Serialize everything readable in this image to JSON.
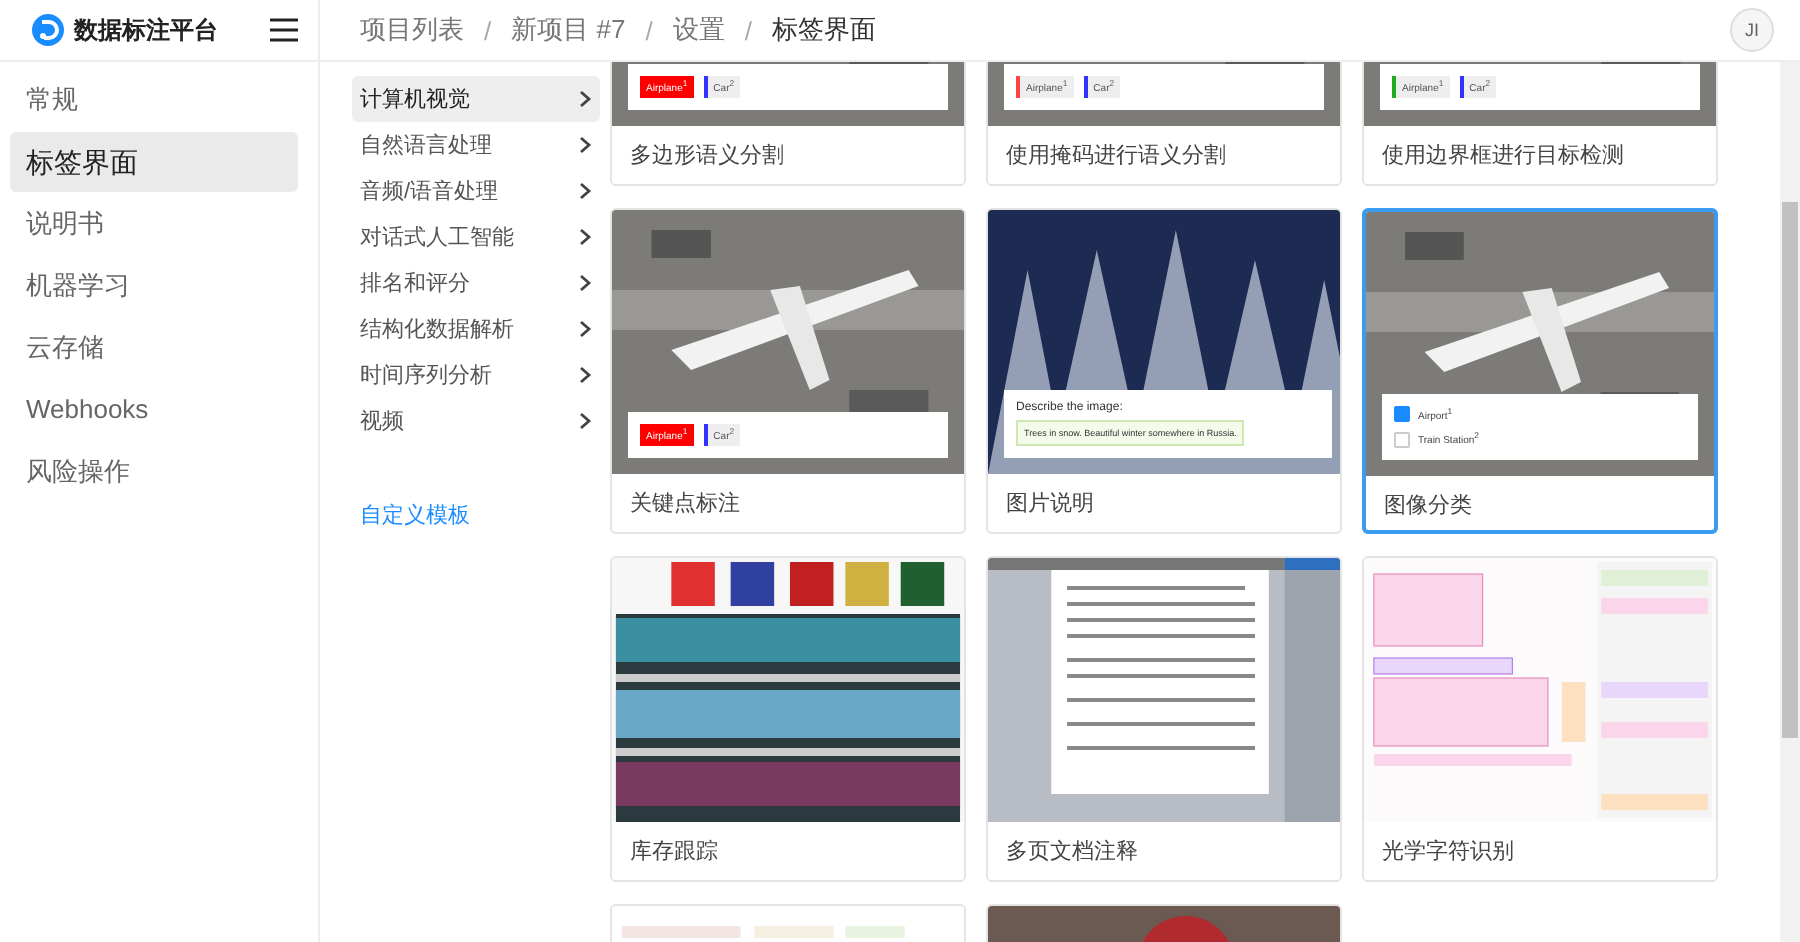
{
  "header": {
    "app_name": "数据标注平台",
    "breadcrumb": [
      {
        "label": "项目列表"
      },
      {
        "sep": "/",
        "label": "新项目 #7"
      },
      {
        "sep": "/",
        "label": "设置"
      },
      {
        "sep": "/",
        "label": "标签界面"
      }
    ],
    "avatar": "JI"
  },
  "sidebar": {
    "items": [
      {
        "label": "常规",
        "selected": false
      },
      {
        "label": "标签界面",
        "selected": true
      },
      {
        "label": "说明书",
        "selected": false
      },
      {
        "label": "机器学习",
        "selected": false
      },
      {
        "label": "云存储",
        "selected": false
      },
      {
        "label": "Webhooks",
        "selected": false
      },
      {
        "label": "风险操作",
        "selected": false
      }
    ]
  },
  "categories": {
    "items": [
      {
        "label": "计算机视觉",
        "selected": true
      },
      {
        "label": "自然语言处理",
        "selected": false
      },
      {
        "label": "音频/语音处理",
        "selected": false
      },
      {
        "label": "对话式人工智能",
        "selected": false
      },
      {
        "label": "排名和评分",
        "selected": false
      },
      {
        "label": "结构化数据解析",
        "selected": false
      },
      {
        "label": "时间序列分析",
        "selected": false
      },
      {
        "label": "视频",
        "selected": false
      }
    ],
    "custom_link": "自定义模板"
  },
  "templates": [
    {
      "title": "多边形语义分割",
      "selected": false,
      "thumb": {
        "kind": "airport",
        "panel": {
          "kind": "chips",
          "chips": [
            {
              "text": "Airplane$^{1}$",
              "color": "#ff0000",
              "selected": true
            },
            {
              "text": "Car$^{2}$",
              "color": "#3333ff",
              "selected": false
            }
          ]
        }
      }
    },
    {
      "title": "使用掩码进行语义分割",
      "selected": false,
      "thumb": {
        "kind": "airport",
        "panel": {
          "kind": "chips",
          "chips": [
            {
              "text": "Airplane$^{1}$",
              "color": "#ff4444",
              "selected": false
            },
            {
              "text": "Car$^{2}$",
              "color": "#3333ff",
              "selected": false
            }
          ]
        }
      }
    },
    {
      "title": "使用边界框进行目标检测",
      "selected": false,
      "thumb": {
        "kind": "airport",
        "panel": {
          "kind": "chips",
          "chips": [
            {
              "text": "Airplane$^{1}$",
              "color": "#22aa22",
              "selected": false
            },
            {
              "text": "Car$^{2}$",
              "color": "#3333ff",
              "selected": false
            }
          ]
        }
      }
    },
    {
      "title": "关键点标注",
      "selected": false,
      "thumb": {
        "kind": "airport",
        "panel": {
          "kind": "chips",
          "chips": [
            {
              "text": "Airplane$^{1}$",
              "color": "#ff0000",
              "selected": true
            },
            {
              "text": "Car$^{2}$",
              "color": "#3333ff",
              "selected": false
            }
          ]
        }
      }
    },
    {
      "title": "图片说明",
      "selected": false,
      "thumb": {
        "kind": "forest",
        "panel": {
          "kind": "caption",
          "prompt": "Describe the image:",
          "answer": "Trees in snow. Beautiful winter somewhere in Russia."
        }
      }
    },
    {
      "title": "图像分类",
      "selected": true,
      "thumb": {
        "kind": "airport",
        "panel": {
          "kind": "choices",
          "choices": [
            {
              "text": "Airport$^{1}$",
              "checked": true
            },
            {
              "text": "Train Station$^{2}$",
              "checked": false
            }
          ]
        }
      }
    },
    {
      "title": "库存跟踪",
      "selected": false,
      "thumb": {
        "kind": "shelves"
      }
    },
    {
      "title": "多页文档注释",
      "selected": false,
      "thumb": {
        "kind": "document"
      }
    },
    {
      "title": "光学字符识别",
      "selected": false,
      "thumb": {
        "kind": "invoice"
      }
    },
    {
      "selected": false,
      "thumb": {
        "kind": "tags"
      }
    },
    {
      "selected": false,
      "thumb": {
        "kind": "photo"
      }
    }
  ]
}
